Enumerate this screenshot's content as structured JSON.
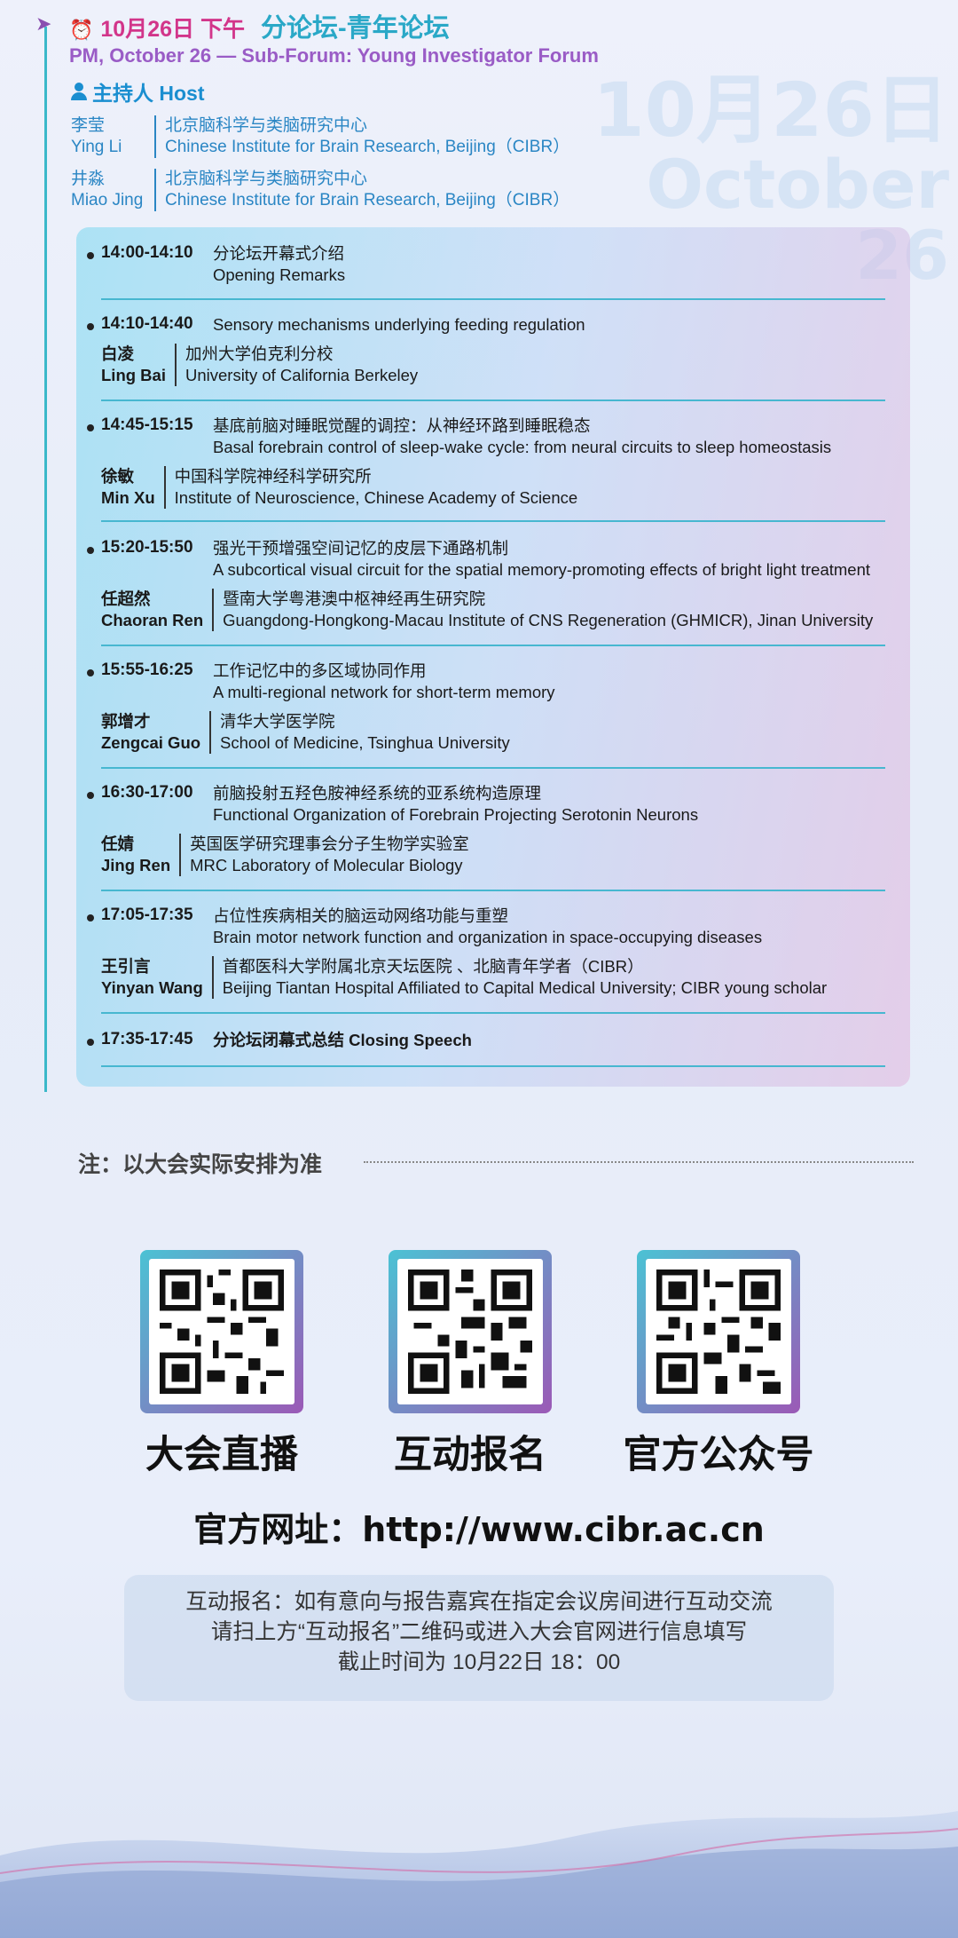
{
  "watermark": {
    "line1": "10月26日",
    "line2": "October 26"
  },
  "header": {
    "date_cn": "10月26日 下午",
    "title_cn": "分论坛-青年论坛",
    "subtitle_en": "PM, October 26 — Sub-Forum: Young Investigator Forum",
    "pin_icon": "pin-arrow-icon",
    "clock_icon": "alarm-clock-icon"
  },
  "host": {
    "title": "主持人 Host",
    "people": [
      {
        "name_cn": "李莹",
        "name_en": "Ying Li",
        "inst_cn": "北京脑科学与类脑研究中心",
        "inst_en": "Chinese Institute for Brain Research, Beijing（CIBR）"
      },
      {
        "name_cn": "井淼",
        "name_en": "Miao Jing",
        "inst_cn": "北京脑科学与类脑研究中心",
        "inst_en": "Chinese Institute for Brain Research, Beijing（CIBR）"
      }
    ]
  },
  "sessions": [
    {
      "time": "14:00-14:10",
      "title_cn": "分论坛开幕式介绍",
      "title_en": "Opening Remarks"
    },
    {
      "time": "14:10-14:40",
      "title_cn": "Sensory mechanisms underlying feeding regulation",
      "title_en": "",
      "speaker_cn": "白凌",
      "speaker_en": "Ling Bai",
      "inst_cn": "加州大学伯克利分校",
      "inst_en": "University of California Berkeley"
    },
    {
      "time": "14:45-15:15",
      "title_cn": "基底前脑对睡眠觉醒的调控：从神经环路到睡眠稳态",
      "title_en": "Basal forebrain control of sleep-wake cycle: from neural circuits to sleep homeostasis",
      "speaker_cn": "徐敏",
      "speaker_en": "Min Xu",
      "inst_cn": "中国科学院神经科学研究所",
      "inst_en": "Institute of Neuroscience, Chinese Academy of Science"
    },
    {
      "time": "15:20-15:50",
      "title_cn": "强光干预增强空间记忆的皮层下通路机制",
      "title_en": "A subcortical visual circuit for the spatial memory-promoting effects of bright light treatment",
      "speaker_cn": "任超然",
      "speaker_en": "Chaoran Ren",
      "inst_cn": "暨南大学粤港澳中枢神经再生研究院",
      "inst_en": "Guangdong-Hongkong-Macau Institute of CNS Regeneration (GHMICR), Jinan University"
    },
    {
      "time": "15:55-16:25",
      "title_cn": "工作记忆中的多区域协同作用",
      "title_en": "A multi-regional network for short-term memory",
      "speaker_cn": "郭增才",
      "speaker_en": "Zengcai Guo",
      "inst_cn": "清华大学医学院",
      "inst_en": "School of Medicine, Tsinghua University"
    },
    {
      "time": "16:30-17:00",
      "title_cn": "前脑投射五羟色胺神经系统的亚系统构造原理",
      "title_en": "Functional Organization of Forebrain Projecting Serotonin Neurons",
      "speaker_cn": "任婧",
      "speaker_en": "Jing Ren",
      "inst_cn": "英国医学研究理事会分子生物学实验室",
      "inst_en": "MRC Laboratory of Molecular Biology"
    },
    {
      "time": "17:05-17:35",
      "title_cn": "占位性疾病相关的脑运动网络功能与重塑",
      "title_en": "Brain motor network function and organization in space-occupying diseases",
      "speaker_cn": "王引言",
      "speaker_en": "Yinyan Wang",
      "inst_cn": "首都医科大学附属北京天坛医院 、北脑青年学者（CIBR）",
      "inst_en": "Beijing Tiantan Hospital Affiliated to Capital Medical University; CIBR young scholar"
    },
    {
      "time": "17:35-17:45",
      "title_cn": "分论坛闭幕式总结  Closing Speech",
      "title_en": ""
    }
  ],
  "note": "注：以大会实际安排为准",
  "qrcodes": [
    {
      "label": "大会直播"
    },
    {
      "label": "互动报名"
    },
    {
      "label": "官方公众号"
    }
  ],
  "website": "官方网址：http://www.cibr.ac.cn",
  "signup": {
    "line1": "互动报名：如有意向与报告嘉宾在指定会议房间进行互动交流",
    "line2": "请扫上方“互动报名”二维码或进入大会官网进行信息填写",
    "line3": "截止时间为 10月22日 18：00"
  },
  "colors": {
    "accent_pink": "#d2358a",
    "accent_cyan": "#2aa8c7",
    "accent_purple": "#9a5cc6",
    "host_blue": "#1a8ed0"
  }
}
